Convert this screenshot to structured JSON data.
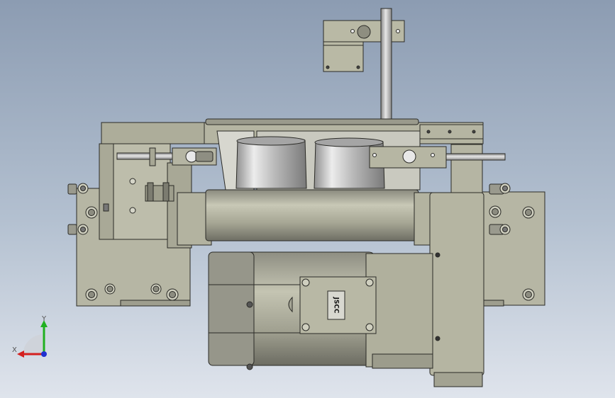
{
  "cad_view": {
    "motor_label": "JSCC",
    "triad": {
      "x_label": "X",
      "y_label": "Y",
      "x_color": "#d42020",
      "y_color": "#20b020",
      "z_color": "#2030d0"
    },
    "colors": {
      "body": "#b8b8a4",
      "body_dark": "#86867a",
      "metal": "#c4c4c2",
      "outline": "#2a2a26"
    }
  }
}
